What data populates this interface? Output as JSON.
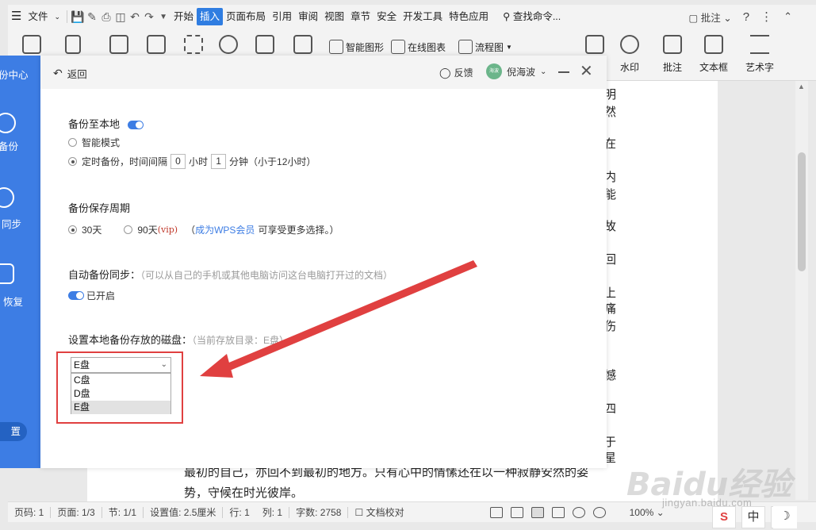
{
  "menubar": {
    "file": "文件",
    "tabs": [
      "开始",
      "插入",
      "页面布局",
      "引用",
      "审阅",
      "视图",
      "章节",
      "安全",
      "开发工具",
      "特色应用"
    ],
    "active_tab": "插入",
    "search": "查找命令...",
    "review": "批注"
  },
  "ribbon": {
    "smart_shape": "智能图形",
    "online_chart": "在线图表",
    "flowchart": "流程图",
    "watermark": "水印",
    "comment": "批注",
    "textbox": "文本框",
    "wordart": "艺术字"
  },
  "leftpanel": {
    "top": "份中心",
    "backup": "备份",
    "sync": "同步",
    "restore": "恢复",
    "settings": "置"
  },
  "dialog": {
    "back": "返回",
    "feedback": "反馈",
    "avatar_text": "海波",
    "username": "倪海波",
    "sec1_title": "备份至本地",
    "smart_mode": "智能模式",
    "timed_prefix": "定时备份，时间间隔",
    "hours_value": "0",
    "hours_unit": "小时",
    "minutes_value": "1",
    "minutes_unit": "分钟（小于12小时）",
    "sec2_title": "备份保存周期",
    "opt_30": "30天",
    "opt_90": "90天",
    "vip": "(vip)",
    "paren_open": "（",
    "member_link": "成为WPS会员",
    "member_tail": "可享受更多选择。）",
    "sec3_title": "自动备份同步：",
    "sec3_hint": "（可以从自己的手机或其他电脑访问这台电脑打开过的文档）",
    "sec3_state": "已开启",
    "sec4_title": "设置本地备份存放的磁盘：",
    "sec4_hint": "（当前存放目录：E盘）",
    "select_value": "E盘",
    "options": [
      "C盘",
      "D盘",
      "E盘"
    ]
  },
  "document": {
    "line1": "最初的自己，亦回不到最初的地方。只有心中的情愫还在以一种寂静安然的姿",
    "line2": "势，守候在时光彼岸。",
    "side_chars": [
      "明",
      "然",
      "在",
      "内",
      "能",
      "故",
      "回",
      "上",
      "痛",
      "伤",
      "",
      "",
      "憾",
      "",
      "四",
      "",
      "于",
      "星"
    ]
  },
  "status": {
    "page_num": "页码: 1",
    "pages": "页面: 1/3",
    "section": "节: 1/1",
    "setting": "设置值: 2.5厘米",
    "row": "行: 1",
    "col": "列: 1",
    "words": "字数: 2758",
    "proof": "文档校对",
    "zoom": "100%"
  },
  "watermark": {
    "logo": "Baidu经验",
    "url": "jingyan.baidu.com"
  },
  "ime": {
    "lang": "中"
  },
  "colors": {
    "accent": "#3d7de4",
    "annotation_red": "#e04040"
  }
}
